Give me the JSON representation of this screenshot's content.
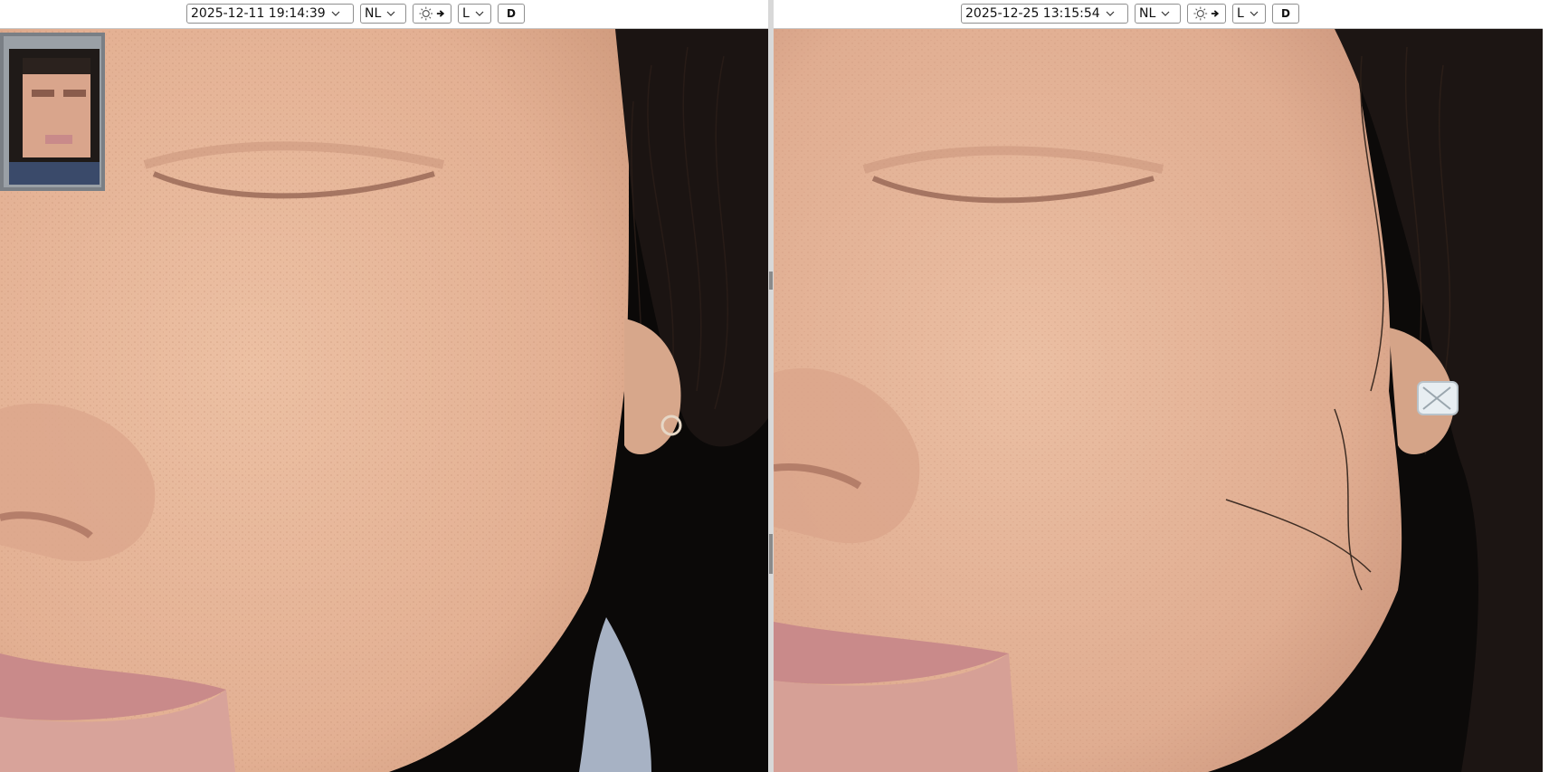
{
  "left_panel": {
    "datetime": "2025-12-11 19:14:39",
    "mode": "NL",
    "light_icon": "sun-arrow-icon",
    "side": "L",
    "d_label": "D",
    "thumbnail_icon": "face-thumbnail"
  },
  "right_panel": {
    "datetime": "2025-12-25 13:15:54",
    "mode": "NL",
    "light_icon": "sun-arrow-icon",
    "side": "L",
    "d_label": "D"
  },
  "colors": {
    "skin": "#e7b79a",
    "skin_dark": "#d49a7c",
    "lips": "#c98a8a",
    "hair": "#1a1412",
    "toolbar_bg": "#ffffff",
    "divider": "#d8d8d8"
  }
}
